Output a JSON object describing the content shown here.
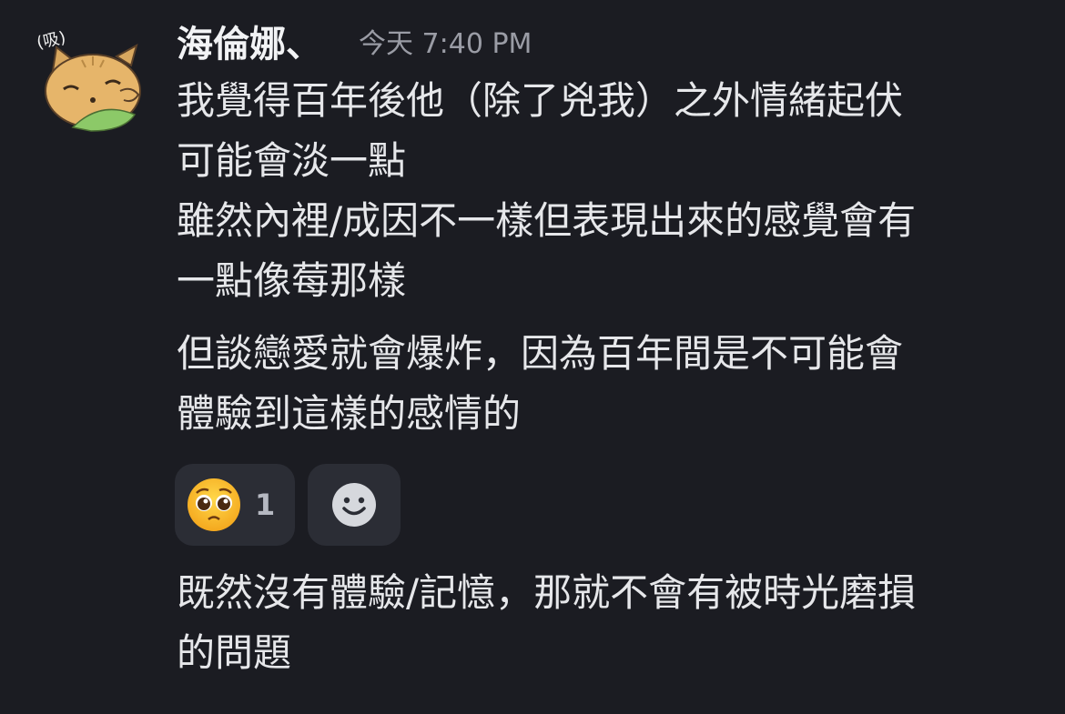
{
  "message": {
    "author": "海倫娜、",
    "timestamp": "今天 7:40 PM",
    "avatar_text": "(吸)",
    "avatar_icon": "cat-avatar-icon",
    "first_block": {
      "lines": [
        "我覺得百年後他（除了兇我）之外情緒起伏",
        "可能會淡一點",
        "雖然內裡/成因不一樣但表現出來的感覺會有",
        "一點像莓那樣"
      ]
    },
    "second_block": {
      "lines": [
        "但談戀愛就會爆炸，因為百年間是不可能會",
        "體驗到這樣的感情的"
      ]
    },
    "reactions": [
      {
        "emoji": "pleading-face-emoji",
        "count": "1"
      }
    ],
    "add_reaction_icon": "smiley-icon",
    "third_block": {
      "lines": [
        "既然沒有體驗/記憶，那就不會有被時光磨損",
        "的問題"
      ]
    }
  },
  "colors": {
    "background": "#1b1c22",
    "text": "#e6e7ea",
    "timestamp": "#9a9ca5",
    "reaction_bg": "#2b2d35"
  }
}
